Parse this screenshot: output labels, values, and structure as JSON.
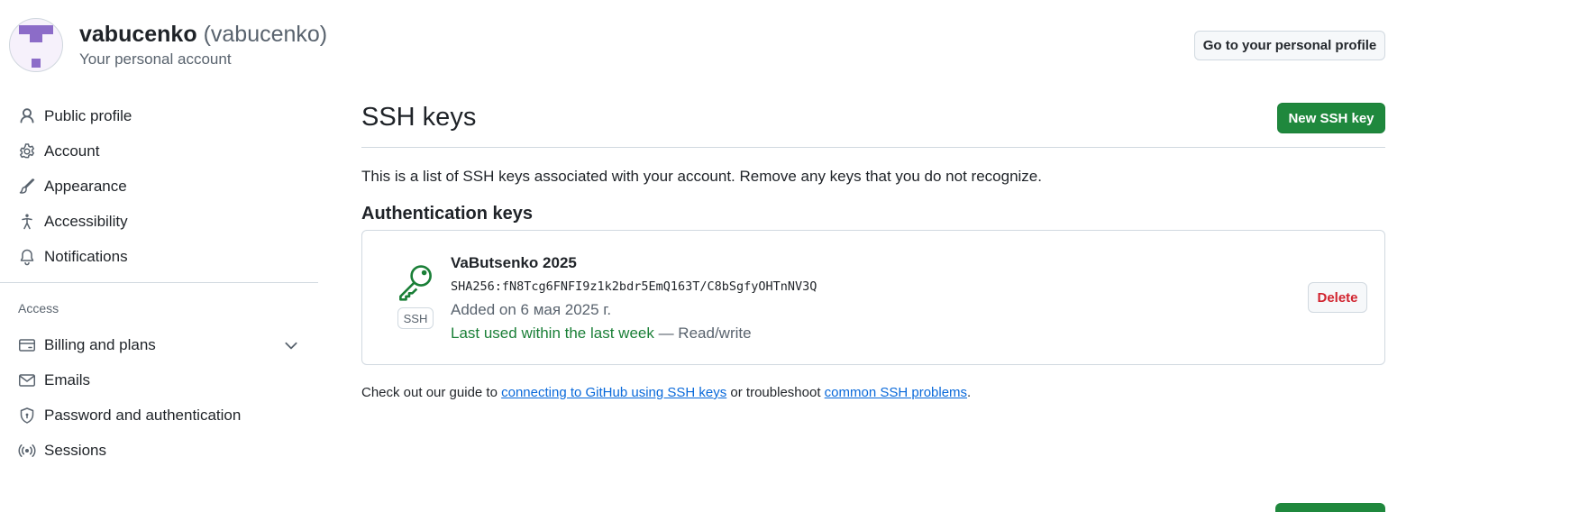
{
  "account": {
    "name": "vabucenko",
    "login": "(vabucenko)",
    "subtitle": "Your personal account",
    "profile_button": "Go to your personal profile"
  },
  "sidebar": {
    "items": [
      {
        "label": "Public profile",
        "icon": "person-icon"
      },
      {
        "label": "Account",
        "icon": "gear-icon"
      },
      {
        "label": "Appearance",
        "icon": "paintbrush-icon"
      },
      {
        "label": "Accessibility",
        "icon": "accessibility-icon"
      },
      {
        "label": "Notifications",
        "icon": "bell-icon"
      }
    ],
    "group_label": "Access",
    "access_items": [
      {
        "label": "Billing and plans",
        "icon": "credit-card-icon"
      },
      {
        "label": "Emails",
        "icon": "mail-icon"
      },
      {
        "label": "Password and authentication",
        "icon": "shield-icon"
      },
      {
        "label": "Sessions",
        "icon": "broadcast-icon"
      }
    ]
  },
  "main": {
    "title": "SSH keys",
    "new_key_button": "New SSH key",
    "intro": "This is a list of SSH keys associated with your account. Remove any keys that you do not recognize.",
    "section_title": "Authentication keys",
    "key": {
      "badge": "SSH",
      "title": "VaButsenko 2025",
      "fingerprint": "SHA256:fN8Tcg6FNFI9z1k2bdr5EmQ163T/C8bSgfyOHTnNV3Q",
      "added": "Added on 6 мая 2025 г.",
      "last_used": "Last used within the last week",
      "access": " — Read/write",
      "delete_button": "Delete"
    },
    "guide": {
      "prefix": "Check out our guide to ",
      "link1": "connecting to GitHub using SSH keys",
      "middle": " or troubleshoot ",
      "link2": "common SSH problems",
      "suffix": "."
    }
  },
  "colors": {
    "primary_button": "#1f883d",
    "link": "#0969da",
    "danger": "#d1242f",
    "success_text": "#1a7f37",
    "muted_text": "#59636e"
  }
}
